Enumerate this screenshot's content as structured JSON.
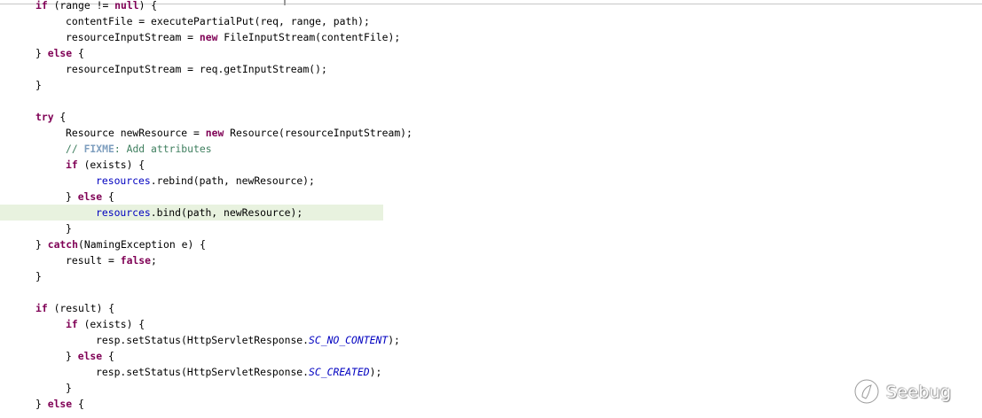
{
  "editor": {
    "lines": [
      {
        "indent": 2,
        "tokens": [
          {
            "t": "if",
            "c": "kw"
          },
          {
            "t": " (range != "
          },
          {
            "t": "null",
            "c": "kw"
          },
          {
            "t": ") {"
          }
        ]
      },
      {
        "indent": 3,
        "tokens": [
          {
            "t": "contentFile = executePartialPut(req, range, path);"
          }
        ]
      },
      {
        "indent": 3,
        "tokens": [
          {
            "t": "resourceInputStream = "
          },
          {
            "t": "new",
            "c": "kw"
          },
          {
            "t": " FileInputStream(contentFile);"
          }
        ]
      },
      {
        "indent": 2,
        "tokens": [
          {
            "t": "} "
          },
          {
            "t": "else",
            "c": "kw"
          },
          {
            "t": " {"
          }
        ]
      },
      {
        "indent": 3,
        "tokens": [
          {
            "t": "resourceInputStream = req.getInputStream();"
          }
        ]
      },
      {
        "indent": 2,
        "tokens": [
          {
            "t": "}"
          }
        ]
      },
      {
        "indent": 0,
        "tokens": []
      },
      {
        "indent": 2,
        "tokens": [
          {
            "t": "try",
            "c": "kw"
          },
          {
            "t": " {"
          }
        ]
      },
      {
        "indent": 3,
        "tokens": [
          {
            "t": "Resource newResource = "
          },
          {
            "t": "new",
            "c": "kw"
          },
          {
            "t": " Resource(resourceInputStream);"
          }
        ]
      },
      {
        "indent": 3,
        "tokens": [
          {
            "t": "// ",
            "c": "comment"
          },
          {
            "t": "FIXME",
            "c": "task"
          },
          {
            "t": ": Add attributes",
            "c": "comment"
          }
        ]
      },
      {
        "indent": 3,
        "tokens": [
          {
            "t": "if",
            "c": "kw"
          },
          {
            "t": " (exists) {"
          }
        ]
      },
      {
        "indent": 4,
        "tokens": [
          {
            "t": "resources",
            "c": "field"
          },
          {
            "t": ".rebind(path, newResource);"
          }
        ]
      },
      {
        "indent": 3,
        "tokens": [
          {
            "t": "} "
          },
          {
            "t": "else",
            "c": "kw"
          },
          {
            "t": " {"
          }
        ]
      },
      {
        "indent": 4,
        "highlight": true,
        "tokens": [
          {
            "t": "resources",
            "c": "field"
          },
          {
            "t": ".bind(path, newResource);"
          }
        ]
      },
      {
        "indent": 3,
        "tokens": [
          {
            "t": "}"
          }
        ]
      },
      {
        "indent": 2,
        "tokens": [
          {
            "t": "} "
          },
          {
            "t": "catch",
            "c": "kw"
          },
          {
            "t": "(NamingException e) {"
          }
        ]
      },
      {
        "indent": 3,
        "tokens": [
          {
            "t": "result = "
          },
          {
            "t": "false",
            "c": "kw"
          },
          {
            "t": ";"
          }
        ]
      },
      {
        "indent": 2,
        "tokens": [
          {
            "t": "}"
          }
        ]
      },
      {
        "indent": 0,
        "tokens": []
      },
      {
        "indent": 2,
        "tokens": [
          {
            "t": "if",
            "c": "kw"
          },
          {
            "t": " (result) {"
          }
        ]
      },
      {
        "indent": 3,
        "tokens": [
          {
            "t": "if",
            "c": "kw"
          },
          {
            "t": " (exists) {"
          }
        ]
      },
      {
        "indent": 4,
        "tokens": [
          {
            "t": "resp.setStatus(HttpServletResponse."
          },
          {
            "t": "SC_NO_CONTENT",
            "c": "const"
          },
          {
            "t": ");"
          }
        ]
      },
      {
        "indent": 3,
        "tokens": [
          {
            "t": "} "
          },
          {
            "t": "else",
            "c": "kw"
          },
          {
            "t": " {"
          }
        ]
      },
      {
        "indent": 4,
        "tokens": [
          {
            "t": "resp.setStatus(HttpServletResponse."
          },
          {
            "t": "SC_CREATED",
            "c": "const"
          },
          {
            "t": ");"
          }
        ]
      },
      {
        "indent": 3,
        "tokens": [
          {
            "t": "}"
          }
        ]
      },
      {
        "indent": 2,
        "tokens": [
          {
            "t": "} "
          },
          {
            "t": "else",
            "c": "kw"
          },
          {
            "t": " {"
          }
        ]
      }
    ]
  },
  "watermark": {
    "icon": "seebug-logo-icon",
    "text": "Seebug"
  },
  "colors": {
    "keyword": "#7f0055",
    "field": "#0000c0",
    "comment": "#3f7f5f",
    "task_tag": "#7f9fbf",
    "highlight_line": "#e8f2df",
    "background": "#ffffff"
  }
}
